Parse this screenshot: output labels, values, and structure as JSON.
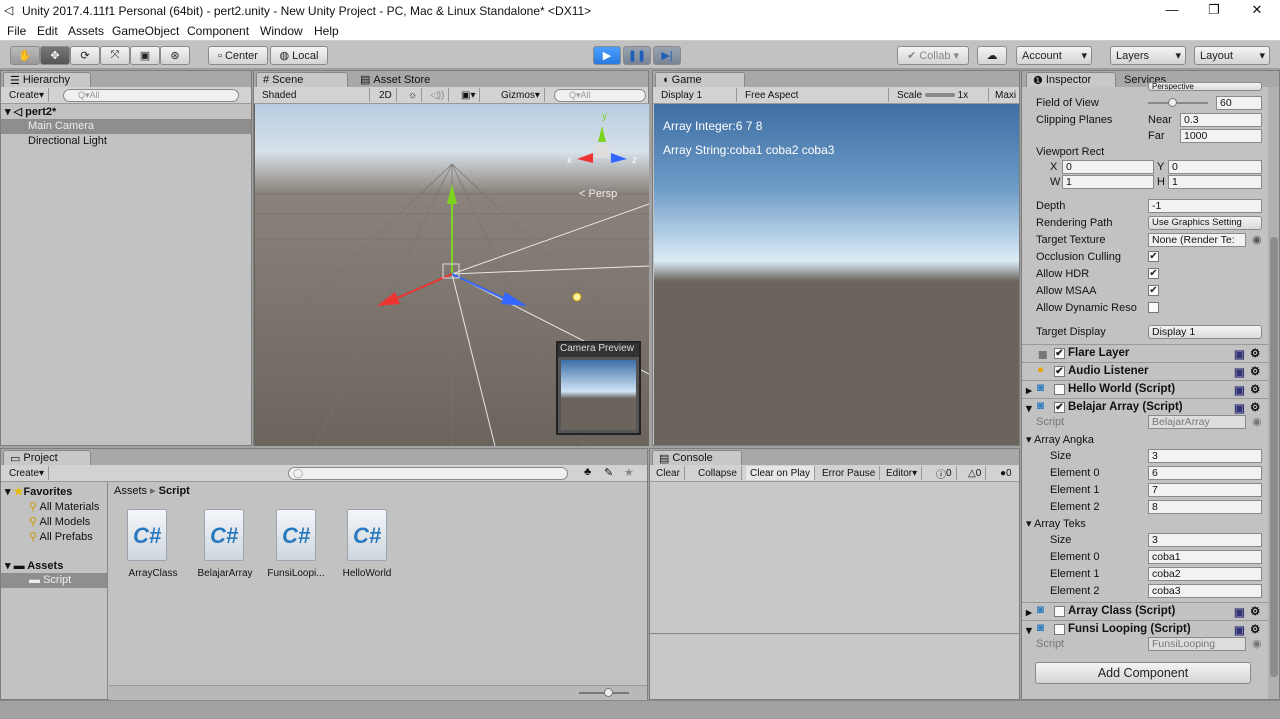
{
  "window": {
    "title": "Unity 2017.4.11f1 Personal (64bit) - pert2.unity - New Unity Project - PC, Mac & Linux Standalone* <DX11>",
    "minimize": "—",
    "maximize": "❐",
    "close": "✕"
  },
  "menu": [
    "File",
    "Edit",
    "Assets",
    "GameObject",
    "Component",
    "Window",
    "Help"
  ],
  "toolbar": {
    "center": "Center",
    "local": "Local",
    "collab": "Collab",
    "account": "Account",
    "layers": "Layers",
    "layout": "Layout",
    "tools": [
      "✋",
      "✥",
      "⟳",
      "⤧",
      "▣",
      "⊛"
    ],
    "play": "▶",
    "pause": "❚❚",
    "step": "▶|",
    "dropdown_arrow": "▾",
    "collab_icon": "✔",
    "cloud_icon": "☁"
  },
  "hierarchy": {
    "tab": "Hierarchy",
    "create": "Create",
    "search": "Q▾All",
    "scene": "pert2*",
    "items": [
      "Main Camera",
      "Directional Light"
    ]
  },
  "scene": {
    "tab_scene": "Scene",
    "tab_asset": "Asset Store",
    "shaded": "Shaded",
    "mode2d": "2D",
    "gizmos": "Gizmos",
    "search": "Q▾All",
    "persp": "< Persp",
    "camera_preview": "Camera Preview",
    "axis_x": "x",
    "axis_y": "y",
    "axis_z": "z"
  },
  "game": {
    "tab": "Game",
    "display": "Display 1",
    "aspect": "Free Aspect",
    "scale_label": "Scale",
    "scale_value": "1x",
    "maximize": "Maxi",
    "line1": "Array Integer:6 7 8",
    "line2": "Array String:coba1 coba2 coba3"
  },
  "inspector": {
    "tab": "Inspector",
    "tab_services": "Services",
    "projection": "Perspective",
    "fov_label": "Field of View",
    "fov_value": "60",
    "fov_slider_fraction": 0.4,
    "clipping_label": "Clipping Planes",
    "near_label": "Near",
    "near_value": "0.3",
    "far_label": "Far",
    "far_value": "1000",
    "viewport_label": "Viewport Rect",
    "x_label": "X",
    "x": "0",
    "y_label": "Y",
    "y": "0",
    "w_label": "W",
    "w": "1",
    "h_label": "H",
    "h": "1",
    "depth_label": "Depth",
    "depth": "-1",
    "rendering_label": "Rendering Path",
    "rendering": "Use Graphics Setting",
    "target_tex_label": "Target Texture",
    "target_tex": "None (Render Te:",
    "occlusion_label": "Occlusion Culling",
    "hdr_label": "Allow HDR",
    "msaa_label": "Allow MSAA",
    "dynres_label": "Allow Dynamic Reso",
    "target_display_label": "Target Display",
    "target_display": "Display 1",
    "comps": [
      "Flare Layer",
      "Audio Listener",
      "Hello World (Script)",
      "Belajar Array (Script)",
      "Array Class (Script)",
      "Funsi Looping (Script)"
    ],
    "script_label": "Script",
    "script_belajar": "BelajarArray",
    "script_funsi": "FunsiLooping",
    "array_angka": "Array Angka",
    "array_teks": "Array Teks",
    "size_label": "Size",
    "el0": "Element 0",
    "el1": "Element 1",
    "el2": "Element 2",
    "angka": [
      "3",
      "6",
      "7",
      "8"
    ],
    "teks": [
      "3",
      "coba1",
      "coba2",
      "coba3"
    ],
    "add_component": "Add Component"
  },
  "project": {
    "tab": "Project",
    "create": "Create",
    "favorites": "Favorites",
    "fav_items": [
      "All Materials",
      "All Models",
      "All Prefabs"
    ],
    "assets": "Assets",
    "script_folder": "Script",
    "breadcrumb_root": "Assets",
    "breadcrumb_sep": "▸",
    "breadcrumb_leaf": "Script",
    "files": [
      "ArrayClass",
      "BelajarArray",
      "FunsiLoopi...",
      "HelloWorld"
    ],
    "cs": "C#"
  },
  "console": {
    "tab": "Console",
    "buttons": [
      "Clear",
      "Collapse",
      "Clear on Play",
      "Error Pause",
      "Editor"
    ],
    "info_count": "0",
    "warn_count": "0",
    "err_count": "0"
  }
}
